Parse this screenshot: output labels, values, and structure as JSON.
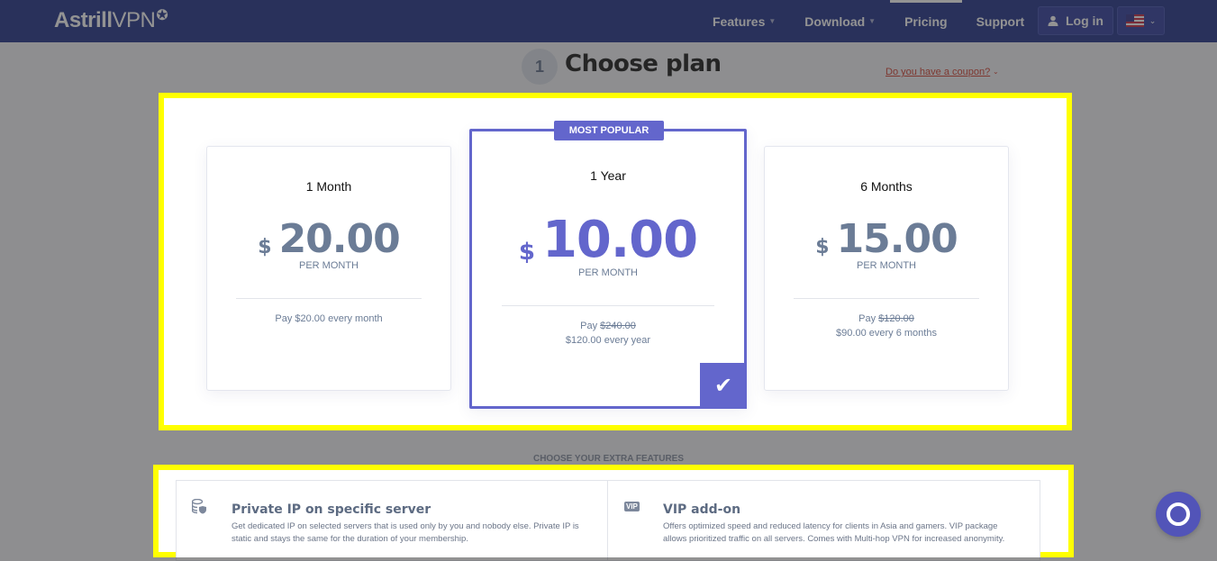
{
  "header": {
    "logo_bold": "Astrill",
    "logo_light": "VPN",
    "logo_star": "✪",
    "nav": [
      {
        "label": "Features",
        "has_dropdown": true
      },
      {
        "label": "Download",
        "has_dropdown": true
      },
      {
        "label": "Pricing",
        "has_dropdown": false,
        "active": true
      },
      {
        "label": "Support",
        "has_dropdown": false
      }
    ],
    "login_label": "Log in",
    "login_icon": "user-icon",
    "language_flag": "us-flag-icon"
  },
  "step": {
    "number": "1",
    "title": "Choose plan",
    "coupon_link": "Do you have a coupon?"
  },
  "plans": [
    {
      "name": "1 Month",
      "currency": "$",
      "amount": "20.00",
      "per": "PER MONTH",
      "pay_line1": "Pay $20.00 every month",
      "pay_strike": "",
      "pay_line2": "",
      "selected": false
    },
    {
      "name": "1 Year",
      "currency": "$",
      "amount": "10.00",
      "per": "PER MONTH",
      "pay_prefix": "Pay ",
      "pay_strike": "$240.00",
      "pay_line2": "$120.00 every year",
      "badge": "MOST POPULAR",
      "selected": true
    },
    {
      "name": "6 Months",
      "currency": "$",
      "amount": "15.00",
      "per": "PER MONTH",
      "pay_prefix": "Pay ",
      "pay_strike": "$120.00",
      "pay_line2": "$90.00 every 6 months",
      "selected": false
    }
  ],
  "extras": {
    "title": "CHOOSE YOUR EXTRA FEATURES",
    "items": [
      {
        "icon": "database-shield-icon",
        "title": "Private IP on specific server",
        "desc": "Get dedicated IP on selected servers that is used only by you and nobody else. Private IP is static and stays the same for the duration of your membership."
      },
      {
        "icon": "vip-icon",
        "icon_text": "VIP",
        "title": "VIP add-on",
        "desc": "Offers optimized speed and reduced latency for clients in Asia and gamers. VIP package allows prioritized traffic on all servers. Comes with Multi-hop VPN for increased anonymity."
      }
    ]
  },
  "colors": {
    "accent": "#6366cc",
    "header_bg": "#2b3a8f",
    "highlight": "#ffff00",
    "coupon": "#d4493a"
  }
}
